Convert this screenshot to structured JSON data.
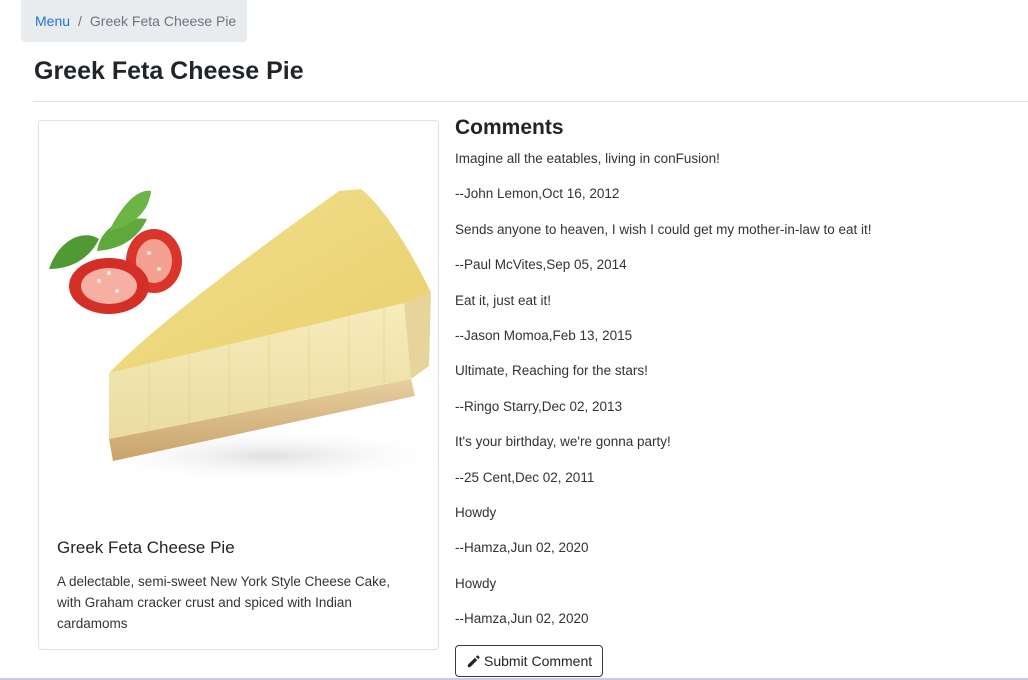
{
  "breadcrumb": {
    "menu_label": "Menu",
    "separator": "/",
    "current": "Greek Feta Cheese Pie"
  },
  "page": {
    "title": "Greek Feta Cheese Pie"
  },
  "dish": {
    "name": "Greek Feta Cheese Pie",
    "description": "A delectable, semi-sweet New York Style Cheese Cake, with Graham cracker crust and spiced with Indian cardamoms",
    "image_icon": "cheesecake-image"
  },
  "comments": {
    "heading": "Comments",
    "items": [
      {
        "text": "Imagine all the eatables, living in conFusion!",
        "byline": "--John Lemon,Oct 16, 2012"
      },
      {
        "text": "Sends anyone to heaven, I wish I could get my mother-in-law to eat it!",
        "byline": "--Paul McVites,Sep 05, 2014"
      },
      {
        "text": "Eat it, just eat it!",
        "byline": "--Jason Momoa,Feb 13, 2015"
      },
      {
        "text": "Ultimate, Reaching for the stars!",
        "byline": "--Ringo Starry,Dec 02, 2013"
      },
      {
        "text": "It's your birthday, we're gonna party!",
        "byline": "--25 Cent,Dec 02, 2011"
      },
      {
        "text": "Howdy",
        "byline": "--Hamza,Jun 02, 2020"
      },
      {
        "text": "Howdy",
        "byline": "--Hamza,Jun 02, 2020"
      }
    ]
  },
  "actions": {
    "submit_comment_label": "Submit Comment",
    "submit_icon": "pencil-icon"
  },
  "colors": {
    "link": "#1e74d6",
    "breadcrumb_bg": "#e9ecef"
  }
}
